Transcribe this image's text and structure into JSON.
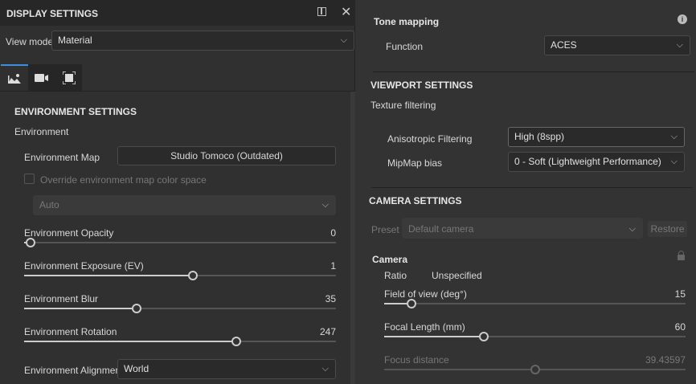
{
  "panel": {
    "title": "DISPLAY SETTINGS",
    "view_mode_label": "View mode",
    "view_mode_value": "Material"
  },
  "tabs": [
    {
      "icon": "environment-icon",
      "active": true
    },
    {
      "icon": "camera-icon"
    },
    {
      "icon": "frame-icon"
    }
  ],
  "environment": {
    "section_title": "ENVIRONMENT SETTINGS",
    "group": "Environment",
    "map_label": "Environment Map",
    "map_value": "Studio Tomoco (Outdated)",
    "override_label": "Override environment map color space",
    "override_checked": false,
    "color_space_value": "Auto",
    "sliders": [
      {
        "label": "Environment Opacity",
        "value": "0",
        "fraction": 0.02
      },
      {
        "label": "Environment Exposure (EV)",
        "value": "1",
        "fraction": 0.54
      },
      {
        "label": "Environment Blur",
        "value": "35",
        "fraction": 0.36
      },
      {
        "label": "Environment Rotation",
        "value": "247",
        "fraction": 0.68
      }
    ],
    "alignment_label": "Environment Alignment",
    "alignment_value": "World"
  },
  "tone": {
    "title": "Tone mapping",
    "function_label": "Function",
    "function_value": "ACES"
  },
  "viewport": {
    "title": "VIEWPORT SETTINGS",
    "texture_label": "Texture filtering",
    "aniso_label": "Anisotropic Filtering",
    "aniso_value": "High (8spp)",
    "mipmap_label": "MipMap bias",
    "mipmap_value": "0 - Soft (Lightweight Performance)"
  },
  "camera": {
    "title": "CAMERA SETTINGS",
    "preset_label": "Preset",
    "preset_value": "Default camera",
    "restore_label": "Restore",
    "group": "Camera",
    "ratio_label": "Ratio",
    "ratio_value": "Unspecified",
    "sliders": [
      {
        "label": "Field of view (deg°)",
        "value": "15",
        "fraction": 0.09
      },
      {
        "label": "Focal Length (mm)",
        "value": "60",
        "fraction": 0.33
      },
      {
        "label": "Focus distance",
        "value": "39.43597",
        "fraction": 0.5,
        "disabled": true
      }
    ]
  },
  "colors": {
    "accent": "#3d8ee0"
  }
}
